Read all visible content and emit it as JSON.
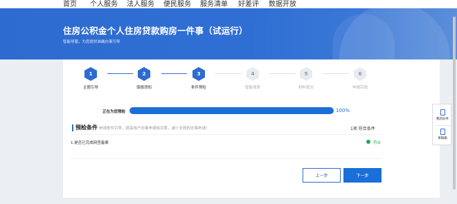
{
  "nav": {
    "items": [
      "首页",
      "个人服务",
      "法人服务",
      "便民服务",
      "服务清单",
      "好差评",
      "数据开放"
    ]
  },
  "banner": {
    "title": "住房公积金个人住房贷款购房一件事（试运行）",
    "subtitle": "智能导服，为您提供准确办事引导"
  },
  "steps": [
    {
      "num": "1",
      "label": "主题引导",
      "state": "done"
    },
    {
      "num": "2",
      "label": "填报须知",
      "state": "done"
    },
    {
      "num": "3",
      "label": "条件预检",
      "state": "done"
    },
    {
      "num": "4",
      "label": "智能填表",
      "state": "todo"
    },
    {
      "num": "5",
      "label": "材料提交",
      "state": "todo"
    },
    {
      "num": "6",
      "label": "申报完成",
      "state": "todo"
    }
  ],
  "progress": {
    "label": "正在为您预检",
    "percent_text": "100%",
    "value": 1.0
  },
  "precheck": {
    "title": "预检条件",
    "description": "申请条件引导，提高用户办事申请成功率，减少无效的办事申请!",
    "count_text": "1项 符合条件",
    "condition": "1.是否已完成网签备案",
    "status": "符合"
  },
  "buttons": {
    "prev": "上一步",
    "next": "下一步"
  },
  "side": {
    "my_items": "我的办件",
    "drafts": "草稿箱"
  },
  "colors": {
    "primary": "#2e6bd0",
    "progress": "#1a6fd8",
    "success": "#2ca45a"
  }
}
